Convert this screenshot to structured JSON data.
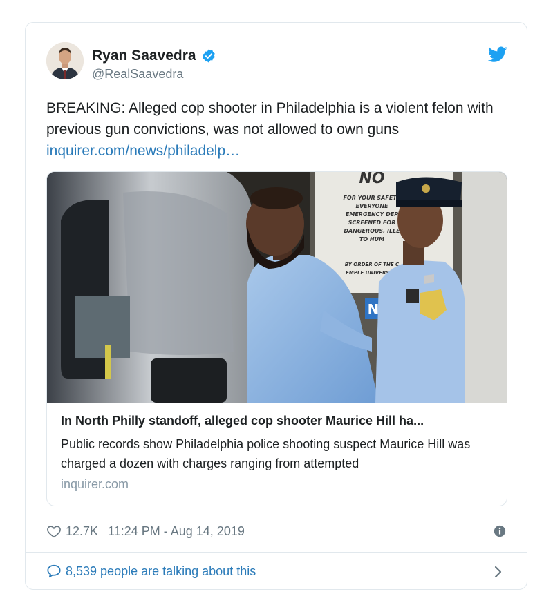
{
  "author": {
    "name": "Ryan Saavedra",
    "handle": "@RealSaavedra"
  },
  "tweet": {
    "text": "BREAKING: Alleged cop shooter in Philadelphia is a violent felon with previous gun convictions, was not allowed to own guns ",
    "link": "inquirer.com/news/philadelp…"
  },
  "card": {
    "sign_top": "NO",
    "sign_lines": [
      "FOR YOUR SAFETY",
      "EVERYONE",
      "EMERGENCY DEP",
      "SCREENED FOR",
      "DANGEROUS, ILLE",
      "TO HUM",
      "BY ORDER OF THE C",
      "EMPLE UNIVERSITY"
    ],
    "small_sign": "N",
    "title": "In North Philly standoff, alleged cop shooter Maurice Hill ha...",
    "description": "Public records show Philadelphia police shooting suspect Maurice Hill was charged a dozen with charges ranging from attempted",
    "domain": "inquirer.com"
  },
  "meta": {
    "likes": "12.7K",
    "timestamp": "11:24 PM - Aug 14, 2019"
  },
  "footer": {
    "talking": "8,539 people are talking about this"
  },
  "icons": {
    "verified": "verified-badge-icon",
    "twitter": "twitter-bird-icon",
    "heart": "heart-icon",
    "info": "info-icon",
    "comment": "comment-bubble-icon",
    "chevron": "chevron-right-icon"
  },
  "colors": {
    "accent": "#1da1f2",
    "link": "#2b7bb9",
    "secondary": "#697882",
    "border": "#e1e8ed"
  }
}
